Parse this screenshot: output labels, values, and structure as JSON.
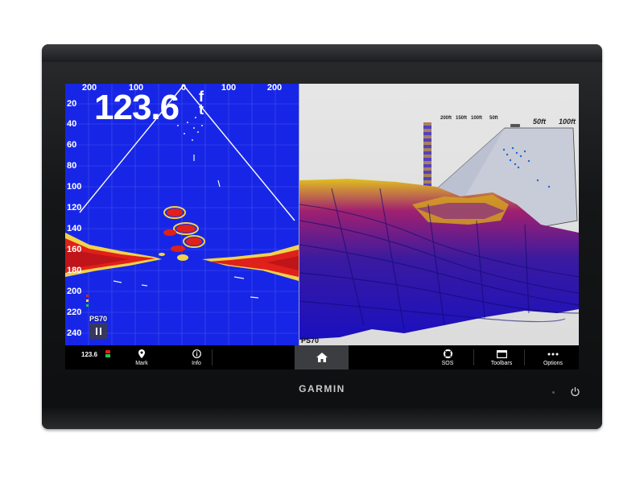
{
  "device": {
    "brand": "GARMIN"
  },
  "sonar_2d": {
    "depth_value": "123.6",
    "depth_unit": "ft",
    "top_scale": [
      "200",
      "100",
      "0",
      "100",
      "200"
    ],
    "depth_scale": [
      "20",
      "40",
      "60",
      "80",
      "100",
      "120",
      "140",
      "160",
      "180",
      "200",
      "220",
      "240"
    ],
    "transducer_label": "PS70",
    "pause_icon": "pause-icon",
    "colors": {
      "background": "#1726e6",
      "return_strong": "#e0201a",
      "return_mid": "#f0d020"
    }
  },
  "sonar_3d": {
    "transducer_label": "PS70",
    "scale_labels": [
      "200ft",
      "150ft",
      "100ft",
      "50ft"
    ],
    "range_labels": [
      "50ft",
      "100ft"
    ]
  },
  "toolbar": {
    "depth_mini": "123.6",
    "mark_label": "Mark",
    "info_label": "Info",
    "home_icon": "home-icon",
    "sos_label": "SOS",
    "toolbars_label": "Toolbars",
    "options_label": "Options"
  }
}
